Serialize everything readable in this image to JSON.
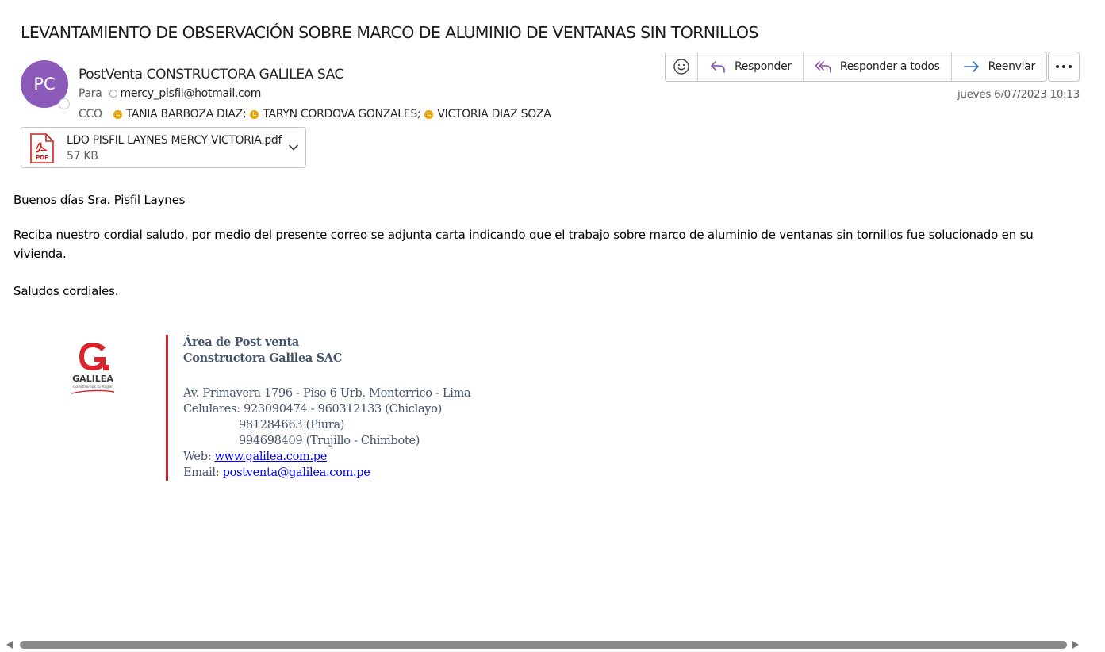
{
  "subject": "LEVANTAMIENTO DE OBSERVACIÓN SOBRE MARCO DE ALUMINIO DE VENTANAS SIN TORNILLOS",
  "sender": {
    "initials": "PC",
    "name": "PostVenta CONSTRUCTORA GALILEA SAC",
    "avatar_color": "#8c5ab8"
  },
  "to": {
    "label": "Para",
    "address": "mercy_pisfil@hotmail.com"
  },
  "cco": {
    "label": "CCO",
    "recipients": [
      "TANIA BARBOZA DIAZ;",
      "TARYN CORDOVA GONZALES;",
      "VICTORIA DIAZ SOZA"
    ],
    "presence_color": "#eaa300"
  },
  "toolbar": {
    "emoji_icon": "smiley-icon",
    "reply": "Responder",
    "reply_all": "Responder a todos",
    "forward": "Reenviar",
    "more_icon": "more-dots-icon",
    "icon_color": "#8c4bb0"
  },
  "date": "jueves 6/07/2023 10:13",
  "attachment": {
    "name": "LDO PISFIL LAYNES MERCY VICTORIA.pdf",
    "size": "57 KB",
    "icon_text": "PDF",
    "icon_color": "#d1231f"
  },
  "body": {
    "greeting": "Buenos días Sra. Pisfil Laynes",
    "paragraph_line1": "Reciba nuestro cordial saludo, por medio del presente correo se adjunta carta indicando que el trabajo sobre marco de aluminio de ventanas sin tornillos fue solucionado en su",
    "paragraph_line2": "vivienda.",
    "closing": "Saludos cordiales."
  },
  "signature": {
    "logo_name": "GALILEA",
    "logo_tagline": "Construimos tu hogar",
    "department": "Área de Post venta",
    "company": "Constructora Galilea SAC",
    "address": "Av. Primavera 1796 - Piso 6 Urb. Monterrico - Lima",
    "phones_label": "Celulares:",
    "phone_line1": "923090474 - 960312133 (Chiclayo)",
    "phone_line2": "981284663 (Piura)",
    "phone_line3": "994698409 (Trujillo - Chimbote)",
    "web_label": "Web:",
    "web": "www.galilea.com.pe",
    "email_label": "Email:",
    "email": "postventa@galilea.com.pe",
    "accent_color": "#c8202a",
    "text_color": "#44546a"
  }
}
